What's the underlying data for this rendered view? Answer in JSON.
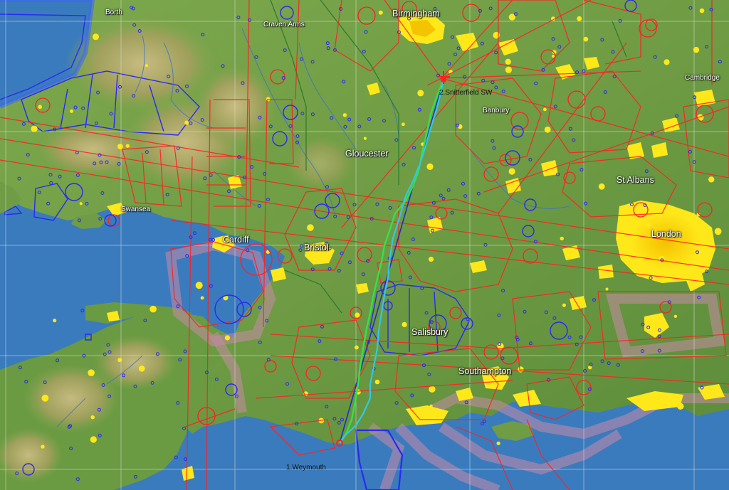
{
  "map": {
    "colors": {
      "sea": "#3a7bbd",
      "land_low": "#6f9c44",
      "land_high": "#c7b07a",
      "urban": "#ffe81a",
      "urban_core": "#f5c400",
      "airspace_class": "#ff2020",
      "airspace_restricted": "#2a2af0",
      "airspace_shade": "#c98aa8",
      "grid": "#c8c8c8",
      "route_track": "#2030c0",
      "gps_track_green": "#37e04a",
      "gps_track_cyan": "#30c8e8"
    },
    "place_labels": [
      {
        "key": "borth",
        "text": "Borth"
      },
      {
        "key": "craven_arms",
        "text": "Craven Arms"
      },
      {
        "key": "birmingham",
        "text": "Birmingham"
      },
      {
        "key": "cambridge",
        "text": "Cambridge"
      },
      {
        "key": "banbury",
        "text": "Banbury"
      },
      {
        "key": "gloucester",
        "text": "Gloucester"
      },
      {
        "key": "st_albans",
        "text": "St Albans"
      },
      {
        "key": "swansea",
        "text": "Swansea"
      },
      {
        "key": "cardiff",
        "text": "Cardiff"
      },
      {
        "key": "bristol",
        "text": "Bristol"
      },
      {
        "key": "london",
        "text": "London"
      },
      {
        "key": "salisbury",
        "text": "Salisbury"
      },
      {
        "key": "southampton",
        "text": "Southampton"
      }
    ],
    "waypoints": [
      {
        "key": "start",
        "text": "1.Weymouth"
      },
      {
        "key": "end",
        "text": "2.Snitterfield SW"
      }
    ]
  }
}
